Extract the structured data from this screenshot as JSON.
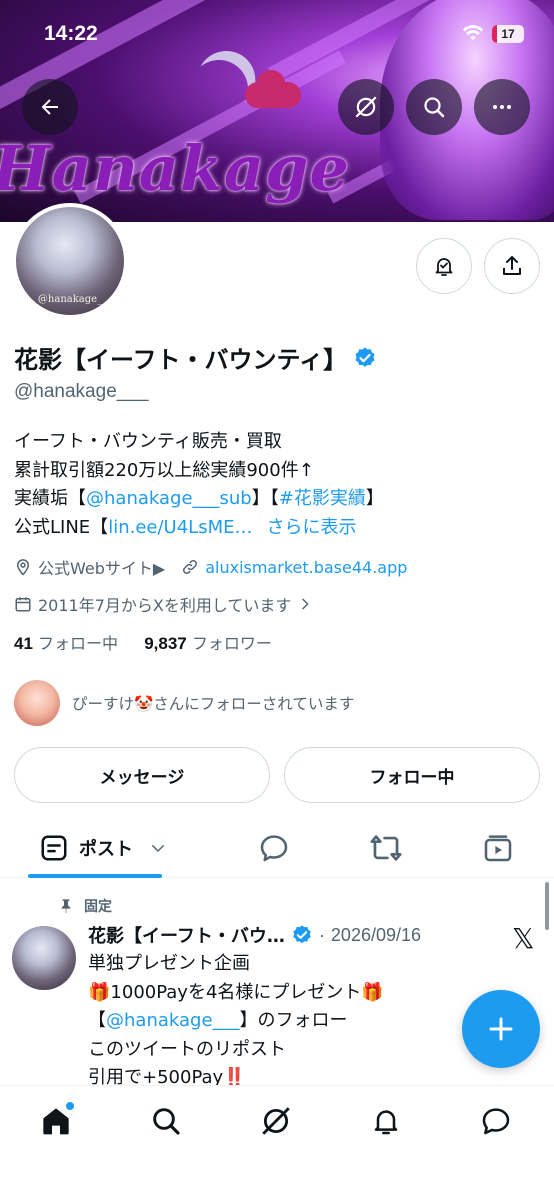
{
  "status_bar": {
    "time": "14:22",
    "battery": "17"
  },
  "banner": {
    "brand_text": "Hanakage"
  },
  "profile": {
    "avatar_caption": "@hanakage_",
    "name": "花影【イーフト・バウンティ】",
    "handle": "@hanakage___",
    "bio": {
      "line1": "イーフト・バウンティ販売・買取",
      "line2": "累計取引額220万以上総実績900件↑",
      "line3_prefix": "実績垢【",
      "line3_link1": "@hanakage___sub",
      "line3_mid": "】【",
      "line3_link2": "#花影実績",
      "line3_suffix": "】",
      "line4_prefix": "公式LINE【",
      "line4_link": "lin.ee/U4LsME…",
      "line4_more": "さらに表示"
    },
    "website_label": "公式Webサイト▶",
    "website_url": "aluxismarket.base44.app",
    "joined": "2011年7月からXを利用しています",
    "following_count": "41",
    "following_label": "フォロー中",
    "followers_count": "9,837",
    "followers_label": "フォロワー",
    "followed_by": "ぴーすけ🤡さんにフォローされています"
  },
  "actions": {
    "message": "メッセージ",
    "following": "フォロー中"
  },
  "tabs": {
    "posts": "ポスト"
  },
  "post": {
    "pinned_label": "固定",
    "author": "花影【イーフト・バウ…",
    "separator": "·",
    "date": "2026/09/16",
    "line1": "単独プレゼント企画",
    "line2": "🎁1000Payを4名様にプレゼント🎁",
    "line3_prefix": "【",
    "line3_link": "@hanakage___",
    "line3_suffix": "】のフォロー",
    "line4": "このツイートのリポスト",
    "line5": "引用で+500Pay‼️"
  },
  "colors": {
    "accent": "#1d9bf0",
    "text": "#0f1419",
    "muted": "#536471",
    "border": "#cfd9de"
  },
  "icons": [
    "back-arrow-icon",
    "grok-icon",
    "search-icon",
    "more-icon",
    "notification-bell-icon",
    "share-icon",
    "verified-icon",
    "location-icon",
    "link-icon",
    "calendar-icon",
    "chevron-right-icon",
    "post-list-icon",
    "chevron-down-icon",
    "reply-icon",
    "repost-icon",
    "media-icon",
    "pin-icon",
    "x-logo-icon",
    "plus-icon",
    "home-icon",
    "search-nav-icon",
    "grok-nav-icon",
    "bell-nav-icon",
    "messages-icon"
  ]
}
